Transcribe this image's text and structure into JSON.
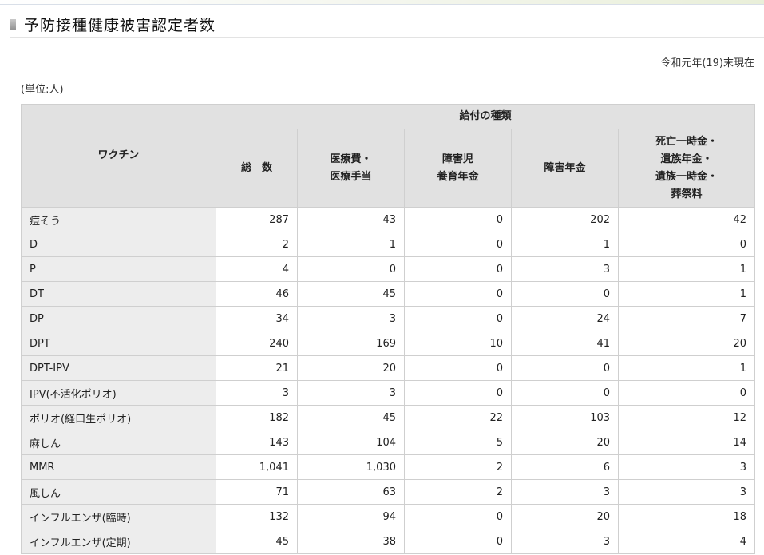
{
  "page": {
    "title": "予防接種健康被害認定者数",
    "date_note": "令和元年(19)末現在",
    "unit_note": "(単位:人)"
  },
  "table": {
    "header": {
      "vaccine": "ワクチン",
      "group": "給付の種類",
      "columns": [
        [
          "総　数"
        ],
        [
          "医療費・",
          "医療手当"
        ],
        [
          "障害児",
          "養育年金"
        ],
        [
          "障害年金"
        ],
        [
          "死亡一時金・",
          "遺族年金・",
          "遺族一時金・",
          "葬祭料"
        ]
      ]
    },
    "rows": [
      {
        "vaccine": "痘そう",
        "values": [
          "287",
          "43",
          "0",
          "202",
          "42"
        ]
      },
      {
        "vaccine": "D",
        "values": [
          "2",
          "1",
          "0",
          "1",
          "0"
        ]
      },
      {
        "vaccine": "P",
        "values": [
          "4",
          "0",
          "0",
          "3",
          "1"
        ]
      },
      {
        "vaccine": "DT",
        "values": [
          "46",
          "45",
          "0",
          "0",
          "1"
        ]
      },
      {
        "vaccine": "DP",
        "values": [
          "34",
          "3",
          "0",
          "24",
          "7"
        ]
      },
      {
        "vaccine": "DPT",
        "values": [
          "240",
          "169",
          "10",
          "41",
          "20"
        ]
      },
      {
        "vaccine": "DPT-IPV",
        "values": [
          "21",
          "20",
          "0",
          "0",
          "1"
        ]
      },
      {
        "vaccine": "IPV(不活化ポリオ)",
        "values": [
          "3",
          "3",
          "0",
          "0",
          "0"
        ]
      },
      {
        "vaccine": "ポリオ(経口生ポリオ)",
        "values": [
          "182",
          "45",
          "22",
          "103",
          "12"
        ]
      },
      {
        "vaccine": "麻しん",
        "values": [
          "143",
          "104",
          "5",
          "20",
          "14"
        ]
      },
      {
        "vaccine": "MMR",
        "values": [
          "1,041",
          "1,030",
          "2",
          "6",
          "3"
        ]
      },
      {
        "vaccine": "風しん",
        "values": [
          "71",
          "63",
          "2",
          "3",
          "3"
        ]
      },
      {
        "vaccine": "インフルエンザ(臨時)",
        "values": [
          "132",
          "94",
          "0",
          "20",
          "18"
        ]
      },
      {
        "vaccine": "インフルエンザ(定期)",
        "values": [
          "45",
          "38",
          "0",
          "3",
          "4"
        ]
      }
    ]
  }
}
